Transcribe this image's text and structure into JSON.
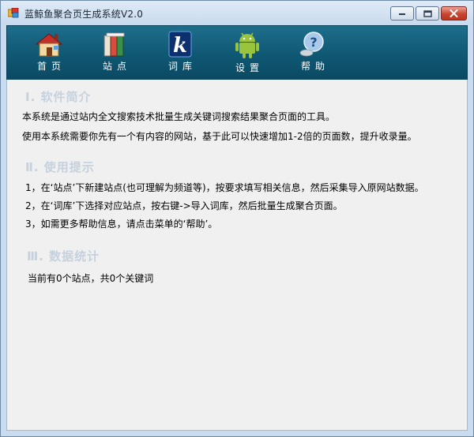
{
  "window": {
    "title": "蓝鲸鱼聚合页生成系统V2.0",
    "accent": "#0f5874",
    "close_color": "#c9442f"
  },
  "toolbar": {
    "items": [
      {
        "label": "首页",
        "icon": "house-icon"
      },
      {
        "label": "站点",
        "icon": "books-icon"
      },
      {
        "label": "词库",
        "icon": "k-letter-icon"
      },
      {
        "label": "设置",
        "icon": "android-robot-icon"
      },
      {
        "label": "帮助",
        "icon": "help-question-icon"
      }
    ]
  },
  "sections": {
    "intro": {
      "title": "Ⅰ. 软件简介",
      "lines": [
        "本系统是通过站内全文搜索技术批量生成关键词搜索结果聚合页面的工具。",
        "使用本系统需要你先有一个有内容的网站，基于此可以快速增加1-2倍的页面数，提升收录量。"
      ]
    },
    "tips": {
      "title": "Ⅱ. 使用提示",
      "lines": [
        "1，在‘站点’下新建站点(也可理解为频道等)，按要求填写相关信息，然后采集导入原网站数据。",
        "2，在‘词库’下选择对应站点，按右键->导入词库，然后批量生成聚合页面。",
        "3，如需更多帮助信息，请点击菜单的‘帮助’。"
      ]
    },
    "stats": {
      "title": "Ⅲ. 数据统计",
      "text": "当前有0个站点，共0个关键词"
    }
  }
}
